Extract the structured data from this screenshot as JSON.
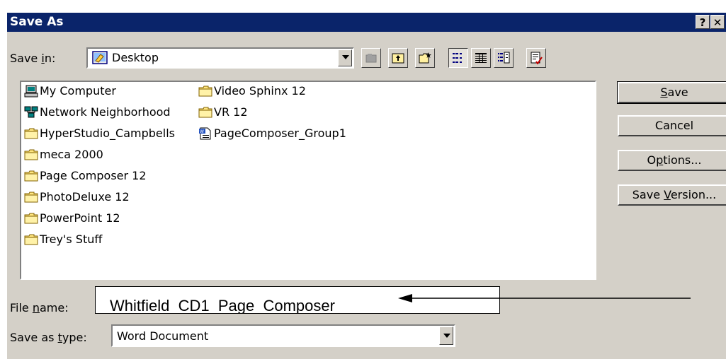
{
  "dialog": {
    "title": "Save As",
    "help_button": "?",
    "close_button": "✕"
  },
  "save_in": {
    "label_prefix": "Save ",
    "label_accel": "i",
    "label_suffix": "n:",
    "value": "Desktop"
  },
  "toolbar": {
    "icons": [
      "back-icon",
      "up-folder-icon",
      "search-web-icon",
      "new-folder-icon",
      "list-view-icon",
      "details-view-icon",
      "properties-view-icon",
      "tools-icon"
    ]
  },
  "files": {
    "col1": [
      {
        "name": "My Computer",
        "icon": "my-computer-icon"
      },
      {
        "name": "Network Neighborhood",
        "icon": "network-neighborhood-icon"
      },
      {
        "name": "HyperStudio_Campbells",
        "icon": "folder-icon"
      },
      {
        "name": "meca 2000",
        "icon": "folder-icon"
      },
      {
        "name": "Page Composer 12",
        "icon": "folder-icon"
      },
      {
        "name": "PhotoDeluxe 12",
        "icon": "folder-icon"
      },
      {
        "name": "PowerPoint 12",
        "icon": "folder-icon"
      },
      {
        "name": "Trey's Stuff",
        "icon": "folder-icon"
      }
    ],
    "col2": [
      {
        "name": "Video Sphinx 12",
        "icon": "folder-icon"
      },
      {
        "name": "VR 12",
        "icon": "folder-icon"
      },
      {
        "name": "PageComposer_Group1",
        "icon": "document-icon"
      }
    ]
  },
  "buttons": {
    "save": {
      "accel": "S",
      "rest": "ave"
    },
    "cancel": "Cancel",
    "options": {
      "pre": "O",
      "accel": "p",
      "rest": "tions..."
    },
    "save_version": {
      "pre": "Save ",
      "accel": "V",
      "rest": "ersion..."
    }
  },
  "file_name": {
    "label_pre": "File ",
    "label_accel": "n",
    "label_rest": "ame:",
    "annotation_text": "Whitfield_CD1_Page_Composer"
  },
  "save_as_type": {
    "label_pre": "Save as ",
    "label_accel": "t",
    "label_rest": "ype:",
    "value": "Word Document"
  }
}
